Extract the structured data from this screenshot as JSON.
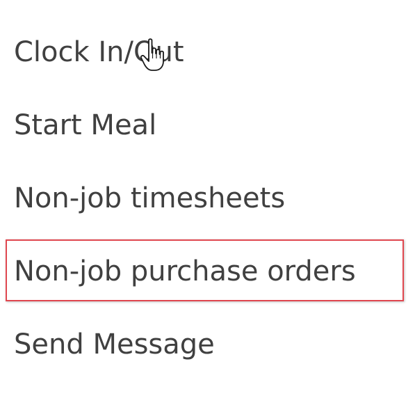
{
  "menu": {
    "items": [
      {
        "label": "Clock In/Out"
      },
      {
        "label": "Start Meal"
      },
      {
        "label": "Non-job timesheets"
      },
      {
        "label": "Non-job purchase orders",
        "highlighted": true
      },
      {
        "label": "Send Message"
      }
    ]
  },
  "cursor": {
    "icon": "hand-pointer-icon"
  },
  "colors": {
    "text": "#404040",
    "highlight_border": "#e0474f",
    "background": "#ffffff"
  }
}
